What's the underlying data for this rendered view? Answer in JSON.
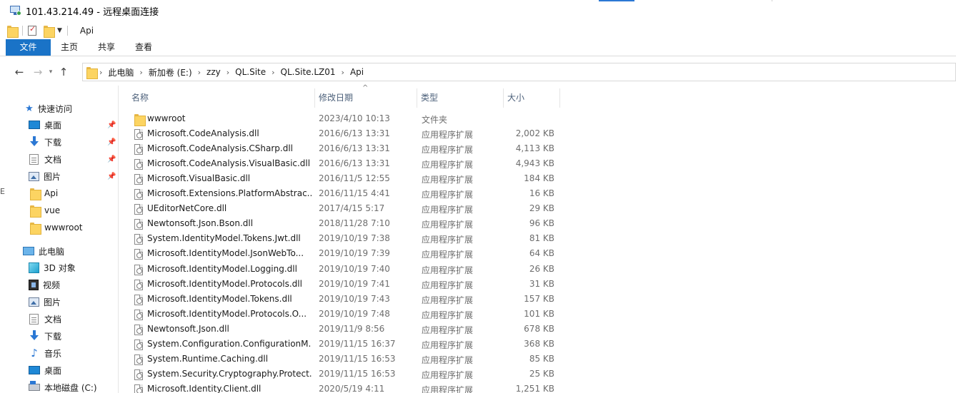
{
  "window": {
    "title": "101.43.214.49 - 远程桌面连接"
  },
  "qat": {
    "title": "Api"
  },
  "ribbon": {
    "tabs": [
      "文件",
      "主页",
      "共享",
      "查看"
    ]
  },
  "address": {
    "crumbs": [
      "此电脑",
      "新加卷 (E:)",
      "zzy",
      "QL.Site",
      "QL.Site.LZ01",
      "Api"
    ]
  },
  "nav": {
    "quick_access": "快速访问",
    "pinned": [
      {
        "label": "桌面",
        "icon": "desktop-icon",
        "pinned": true
      },
      {
        "label": "下载",
        "icon": "download-icon",
        "pinned": true
      },
      {
        "label": "文档",
        "icon": "document-icon",
        "pinned": true
      },
      {
        "label": "图片",
        "icon": "picture-icon",
        "pinned": true
      },
      {
        "label": "Api",
        "icon": "folder-icon",
        "pinned": false
      },
      {
        "label": "vue",
        "icon": "folder-icon",
        "pinned": false
      },
      {
        "label": "wwwroot",
        "icon": "folder-icon",
        "pinned": false
      }
    ],
    "this_pc": "此电脑",
    "pc_items": [
      {
        "label": "3D 对象",
        "icon": "3d-objects-icon"
      },
      {
        "label": "视频",
        "icon": "video-icon"
      },
      {
        "label": "图片",
        "icon": "picture-icon"
      },
      {
        "label": "文档",
        "icon": "document-icon"
      },
      {
        "label": "下载",
        "icon": "download-icon"
      },
      {
        "label": "音乐",
        "icon": "music-icon"
      },
      {
        "label": "桌面",
        "icon": "desktop-icon"
      },
      {
        "label": "本地磁盘 (C:)",
        "icon": "disk-icon"
      }
    ]
  },
  "columns": {
    "name": "名称",
    "date": "修改日期",
    "type": "类型",
    "size": "大小"
  },
  "files": [
    {
      "name": "wwwroot",
      "date": "2023/4/10 10:13",
      "type": "文件夹",
      "size": "",
      "kind": "folder"
    },
    {
      "name": "Microsoft.CodeAnalysis.dll",
      "date": "2016/6/13 13:31",
      "type": "应用程序扩展",
      "size": "2,002 KB",
      "kind": "dll"
    },
    {
      "name": "Microsoft.CodeAnalysis.CSharp.dll",
      "date": "2016/6/13 13:31",
      "type": "应用程序扩展",
      "size": "4,113 KB",
      "kind": "dll"
    },
    {
      "name": "Microsoft.CodeAnalysis.VisualBasic.dll",
      "date": "2016/6/13 13:31",
      "type": "应用程序扩展",
      "size": "4,943 KB",
      "kind": "dll"
    },
    {
      "name": "Microsoft.VisualBasic.dll",
      "date": "2016/11/5 12:55",
      "type": "应用程序扩展",
      "size": "184 KB",
      "kind": "dll"
    },
    {
      "name": "Microsoft.Extensions.PlatformAbstrac...",
      "date": "2016/11/15 4:41",
      "type": "应用程序扩展",
      "size": "16 KB",
      "kind": "dll"
    },
    {
      "name": "UEditorNetCore.dll",
      "date": "2017/4/15 5:17",
      "type": "应用程序扩展",
      "size": "29 KB",
      "kind": "dll"
    },
    {
      "name": "Newtonsoft.Json.Bson.dll",
      "date": "2018/11/28 7:10",
      "type": "应用程序扩展",
      "size": "96 KB",
      "kind": "dll"
    },
    {
      "name": "System.IdentityModel.Tokens.Jwt.dll",
      "date": "2019/10/19 7:38",
      "type": "应用程序扩展",
      "size": "81 KB",
      "kind": "dll"
    },
    {
      "name": "Microsoft.IdentityModel.JsonWebTo...",
      "date": "2019/10/19 7:39",
      "type": "应用程序扩展",
      "size": "64 KB",
      "kind": "dll"
    },
    {
      "name": "Microsoft.IdentityModel.Logging.dll",
      "date": "2019/10/19 7:40",
      "type": "应用程序扩展",
      "size": "26 KB",
      "kind": "dll"
    },
    {
      "name": "Microsoft.IdentityModel.Protocols.dll",
      "date": "2019/10/19 7:41",
      "type": "应用程序扩展",
      "size": "31 KB",
      "kind": "dll"
    },
    {
      "name": "Microsoft.IdentityModel.Tokens.dll",
      "date": "2019/10/19 7:43",
      "type": "应用程序扩展",
      "size": "157 KB",
      "kind": "dll"
    },
    {
      "name": "Microsoft.IdentityModel.Protocols.O...",
      "date": "2019/10/19 7:48",
      "type": "应用程序扩展",
      "size": "101 KB",
      "kind": "dll"
    },
    {
      "name": "Newtonsoft.Json.dll",
      "date": "2019/11/9 8:56",
      "type": "应用程序扩展",
      "size": "678 KB",
      "kind": "dll"
    },
    {
      "name": "System.Configuration.ConfigurationM...",
      "date": "2019/11/15 16:37",
      "type": "应用程序扩展",
      "size": "368 KB",
      "kind": "dll"
    },
    {
      "name": "System.Runtime.Caching.dll",
      "date": "2019/11/15 16:53",
      "type": "应用程序扩展",
      "size": "85 KB",
      "kind": "dll"
    },
    {
      "name": "System.Security.Cryptography.Protect...",
      "date": "2019/11/15 16:53",
      "type": "应用程序扩展",
      "size": "25 KB",
      "kind": "dll"
    },
    {
      "name": "Microsoft.Identity.Client.dll",
      "date": "2020/5/19 4:11",
      "type": "应用程序扩展",
      "size": "1,251 KB",
      "kind": "dll"
    }
  ],
  "colors": {
    "accent": "#1a73c7",
    "folder": "#fcd462",
    "header_text": "#4c607a"
  }
}
